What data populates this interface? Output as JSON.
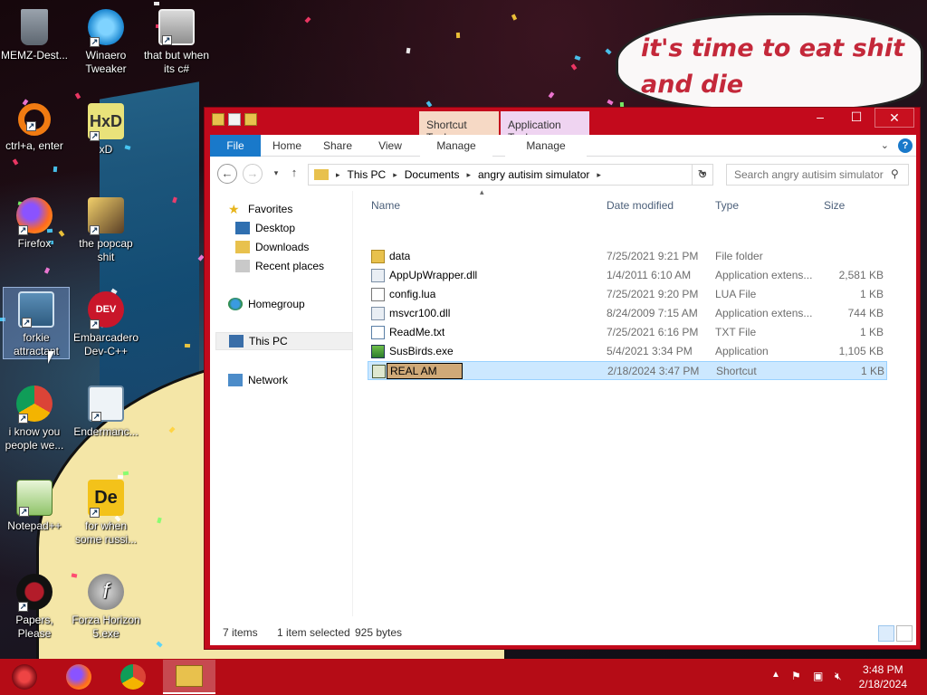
{
  "desktop": {
    "speech_text": "it's time to eat shit and die andcelebrate",
    "icons": [
      {
        "label": "MEMZ-Dest...",
        "icon": "recycle-bin-icon"
      },
      {
        "label": "Winaero Tweaker",
        "icon": "winaero-icon"
      },
      {
        "label": "that but when its c#",
        "icon": "copies-icon"
      },
      {
        "label": "ctrl+a, enter",
        "icon": "ring-icon"
      },
      {
        "label": "xD",
        "icon": "hxd-icon"
      },
      {
        "label": "Firefox",
        "icon": "firefox-icon"
      },
      {
        "label": "the popcap shit",
        "icon": "popcap-icon"
      },
      {
        "label": "forkie attractant",
        "icon": "computer-gear-icon"
      },
      {
        "label": "Embarcadero Dev-C++",
        "icon": "devcpp-icon"
      },
      {
        "label": "i know you people we...",
        "icon": "chrome-icon"
      },
      {
        "label": "Endermanc...",
        "icon": "window-icon"
      },
      {
        "label": "Notepad++",
        "icon": "notepadpp-icon"
      },
      {
        "label": "for when some russi...",
        "icon": "de-icon"
      },
      {
        "label": "Papers, Please",
        "icon": "papers-please-icon"
      },
      {
        "label": "Forza Horizon 5.exe",
        "icon": "flash-icon"
      }
    ]
  },
  "explorer": {
    "context_tabs": {
      "shortcut_tools": "Shortcut Tools",
      "application_tools": "Application Tools"
    },
    "ribbon": {
      "file": "File",
      "home": "Home",
      "share": "Share",
      "view": "View",
      "manage1": "Manage",
      "manage2": "Manage",
      "help": "?"
    },
    "address": {
      "crumbs": [
        "This PC",
        "Documents",
        "angry autisim simulator"
      ]
    },
    "search_placeholder": "Search angry autisim simulator",
    "nav": {
      "favorites": "Favorites",
      "desktop": "Desktop",
      "downloads": "Downloads",
      "recent": "Recent places",
      "homegroup": "Homegroup",
      "thispc": "This PC",
      "network": "Network"
    },
    "columns": {
      "name": "Name",
      "date": "Date modified",
      "type": "Type",
      "size": "Size"
    },
    "files": [
      {
        "name": "data",
        "date": "7/25/2021 9:21 PM",
        "type": "File folder",
        "size": "",
        "icon": "folder-icon"
      },
      {
        "name": "AppUpWrapper.dll",
        "date": "1/4/2011 6:10 AM",
        "type": "Application extens...",
        "size": "2,581 KB",
        "icon": "dll-icon"
      },
      {
        "name": "config.lua",
        "date": "7/25/2021 9:20 PM",
        "type": "LUA File",
        "size": "1 KB",
        "icon": "file-icon"
      },
      {
        "name": "msvcr100.dll",
        "date": "8/24/2009 7:15 AM",
        "type": "Application extens...",
        "size": "744 KB",
        "icon": "dll-icon"
      },
      {
        "name": "ReadMe.txt",
        "date": "7/25/2021 6:16 PM",
        "type": "TXT File",
        "size": "1 KB",
        "icon": "text-file-icon"
      },
      {
        "name": "SusBirds.exe",
        "date": "5/4/2021 3:34 PM",
        "type": "Application",
        "size": "1,105 KB",
        "icon": "exe-icon"
      },
      {
        "name": "REAL AM",
        "date": "2/18/2024 3:47 PM",
        "type": "Shortcut",
        "size": "1 KB",
        "icon": "shortcut-icon"
      }
    ],
    "status": {
      "items": "7 items",
      "selected": "1 item selected",
      "bytes": "925 bytes"
    }
  },
  "taskbar": {
    "time": "3:48 PM",
    "date": "2/18/2024"
  },
  "colors": {
    "window_frame": "#c30a1c",
    "accent": "#1979ca",
    "taskbar": "#b50c16"
  }
}
